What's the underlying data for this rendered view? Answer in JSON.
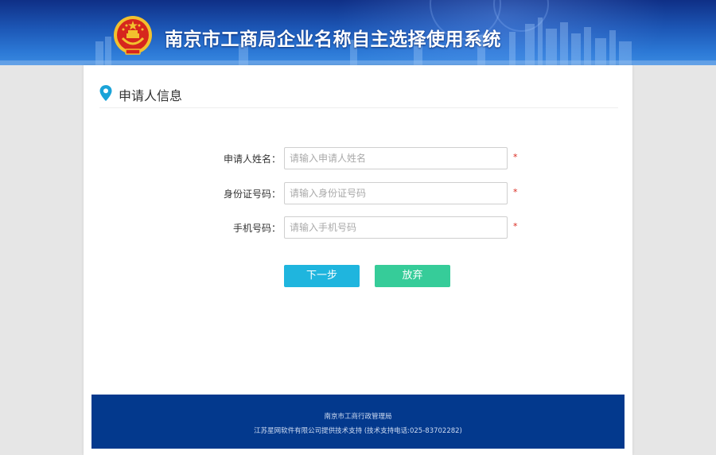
{
  "header": {
    "title": "南京市工商局企业名称自主选择使用系统",
    "emblem_icon": "national-emblem-icon"
  },
  "section": {
    "title": "申请人信息",
    "icon": "location-pin-icon"
  },
  "form": {
    "fields": [
      {
        "label": "申请人姓名：",
        "placeholder": "请输入申请人姓名",
        "value": "",
        "required_mark": "*"
      },
      {
        "label": "身份证号码：",
        "placeholder": "请输入身份证号码",
        "value": "",
        "required_mark": "*"
      },
      {
        "label": "手机号码：",
        "placeholder": "请输入手机号码",
        "value": "",
        "required_mark": "*"
      }
    ],
    "next_label": "下一步",
    "cancel_label": "放弃"
  },
  "footer": {
    "line1": "南京市工商行政管理局",
    "line2": "江苏星网软件有限公司提供技术支持 (技术支持电话:025-83702282)"
  },
  "colors": {
    "banner": "#1d58b7",
    "footer": "#03398d",
    "next_button": "#1fb5de",
    "cancel_button": "#36cc99",
    "required": "#d9261c",
    "pin": "#1aa3d8"
  }
}
